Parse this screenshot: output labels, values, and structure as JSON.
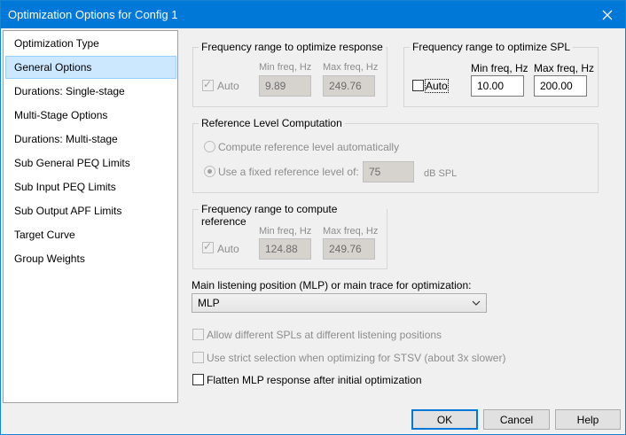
{
  "window": {
    "title": "Optimization Options for Config 1"
  },
  "sidebar": {
    "items": [
      {
        "label": "Optimization Type"
      },
      {
        "label": "General Options"
      },
      {
        "label": "Durations: Single-stage"
      },
      {
        "label": "Multi-Stage Options"
      },
      {
        "label": "Durations: Multi-stage"
      },
      {
        "label": "Sub General PEQ Limits"
      },
      {
        "label": "Sub Input PEQ Limits"
      },
      {
        "label": "Sub Output APF Limits"
      },
      {
        "label": "Target Curve"
      },
      {
        "label": "Group Weights"
      }
    ],
    "selected": "General Options"
  },
  "freq_response": {
    "title": "Frequency range to optimize response",
    "auto_label": "Auto",
    "auto_checked": true,
    "min_label": "Min freq, Hz",
    "max_label": "Max freq, Hz",
    "min_value": "9.89",
    "max_value": "249.76"
  },
  "freq_spl": {
    "title": "Frequency range to optimize SPL",
    "auto_label": "Auto",
    "auto_checked": false,
    "min_label": "Min freq, Hz",
    "max_label": "Max freq, Hz",
    "min_value": "10.00",
    "max_value": "200.00"
  },
  "ref_level": {
    "title": "Reference Level Computation",
    "option_auto": "Compute reference level automatically",
    "option_fixed": "Use a fixed reference level of:",
    "selected": "fixed",
    "fixed_value": "75",
    "unit": "dB SPL"
  },
  "freq_reference": {
    "title": "Frequency range to compute reference",
    "auto_label": "Auto",
    "auto_checked": true,
    "min_label": "Min freq, Hz",
    "max_label": "Max freq, Hz",
    "min_value": "124.88",
    "max_value": "249.76"
  },
  "mlp": {
    "label": "Main listening position (MLP) or main trace for optimization:",
    "selected": "MLP"
  },
  "options": {
    "allow_different_spl": "Allow different SPLs at different listening positions",
    "strict_selection": "Use strict selection when optimizing for STSV (about 3x slower)",
    "flatten_mlp": "Flatten MLP response after initial optimization"
  },
  "footer": {
    "ok": "OK",
    "cancel": "Cancel",
    "help": "Help"
  },
  "colors": {
    "titlebar": "#0078d7",
    "selection": "#cce8ff",
    "default_button_border": "#0078d7"
  }
}
